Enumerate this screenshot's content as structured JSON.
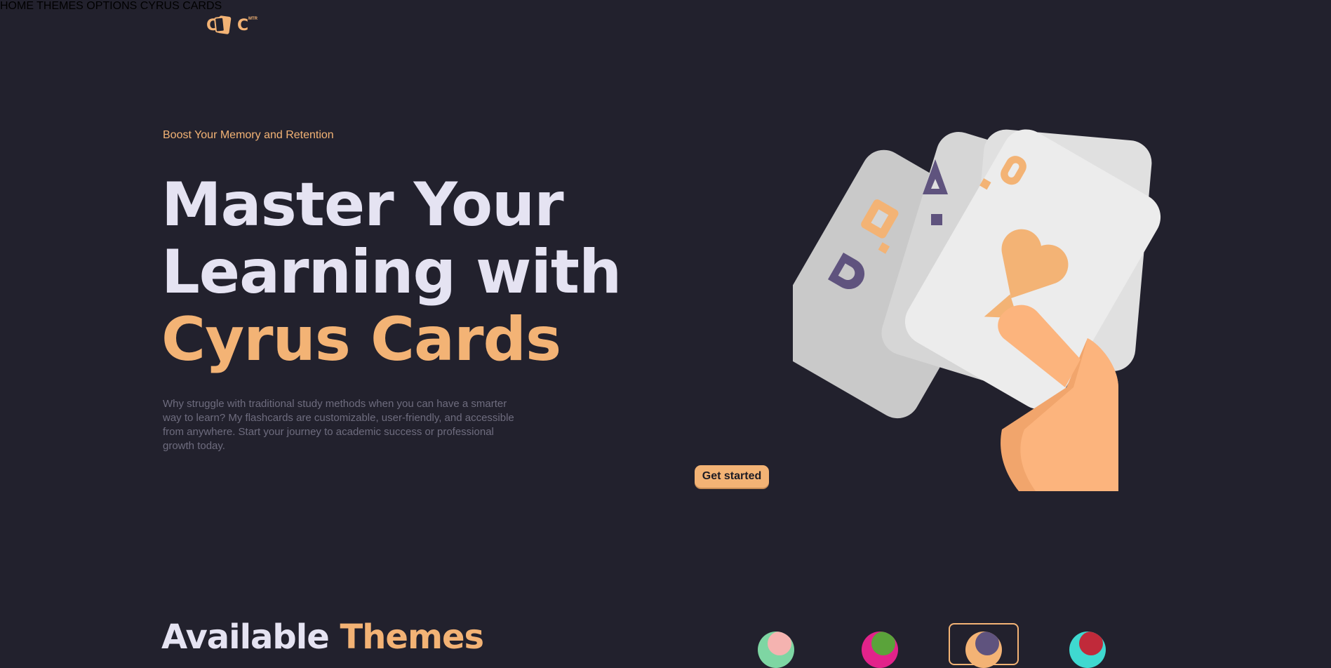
{
  "header": {
    "logo": {
      "left": "C",
      "right": "C",
      "sup": "MTR"
    },
    "nav": [
      {
        "label": "HOME"
      },
      {
        "label": "THEMES"
      },
      {
        "label": "OPTIONS"
      },
      {
        "label": "CYRUS CARDS"
      }
    ]
  },
  "hero": {
    "eyebrow": "Boost Your Memory and Retention",
    "headline_line1": "Master Your",
    "headline_line2": "Learning with",
    "headline_accent": "Cyrus Cards",
    "description": "Why struggle with traditional study methods when you can have a smarter way to learn? My flashcards are customizable, user-friendly, and accessible from anywhere. Start your journey to academic success or professional growth today.",
    "cta_label": "Get started"
  },
  "themes": {
    "title_main": "Available",
    "title_accent": "Themes",
    "swatches": [
      {
        "name": "mint-pink",
        "base": "#7ed6a3",
        "dot": "#f5b3b0",
        "selected": false
      },
      {
        "name": "magenta-green",
        "base": "#e2238a",
        "dot": "#5aa33a",
        "selected": false
      },
      {
        "name": "orange-purple",
        "base": "#f3b375",
        "dot": "#5f537e",
        "selected": true
      },
      {
        "name": "teal-red",
        "base": "#3fd9d0",
        "dot": "#c02a3a",
        "selected": false
      }
    ]
  },
  "colors": {
    "background": "#22212d",
    "accent": "#f3b375",
    "text": "#e5e3f2"
  }
}
